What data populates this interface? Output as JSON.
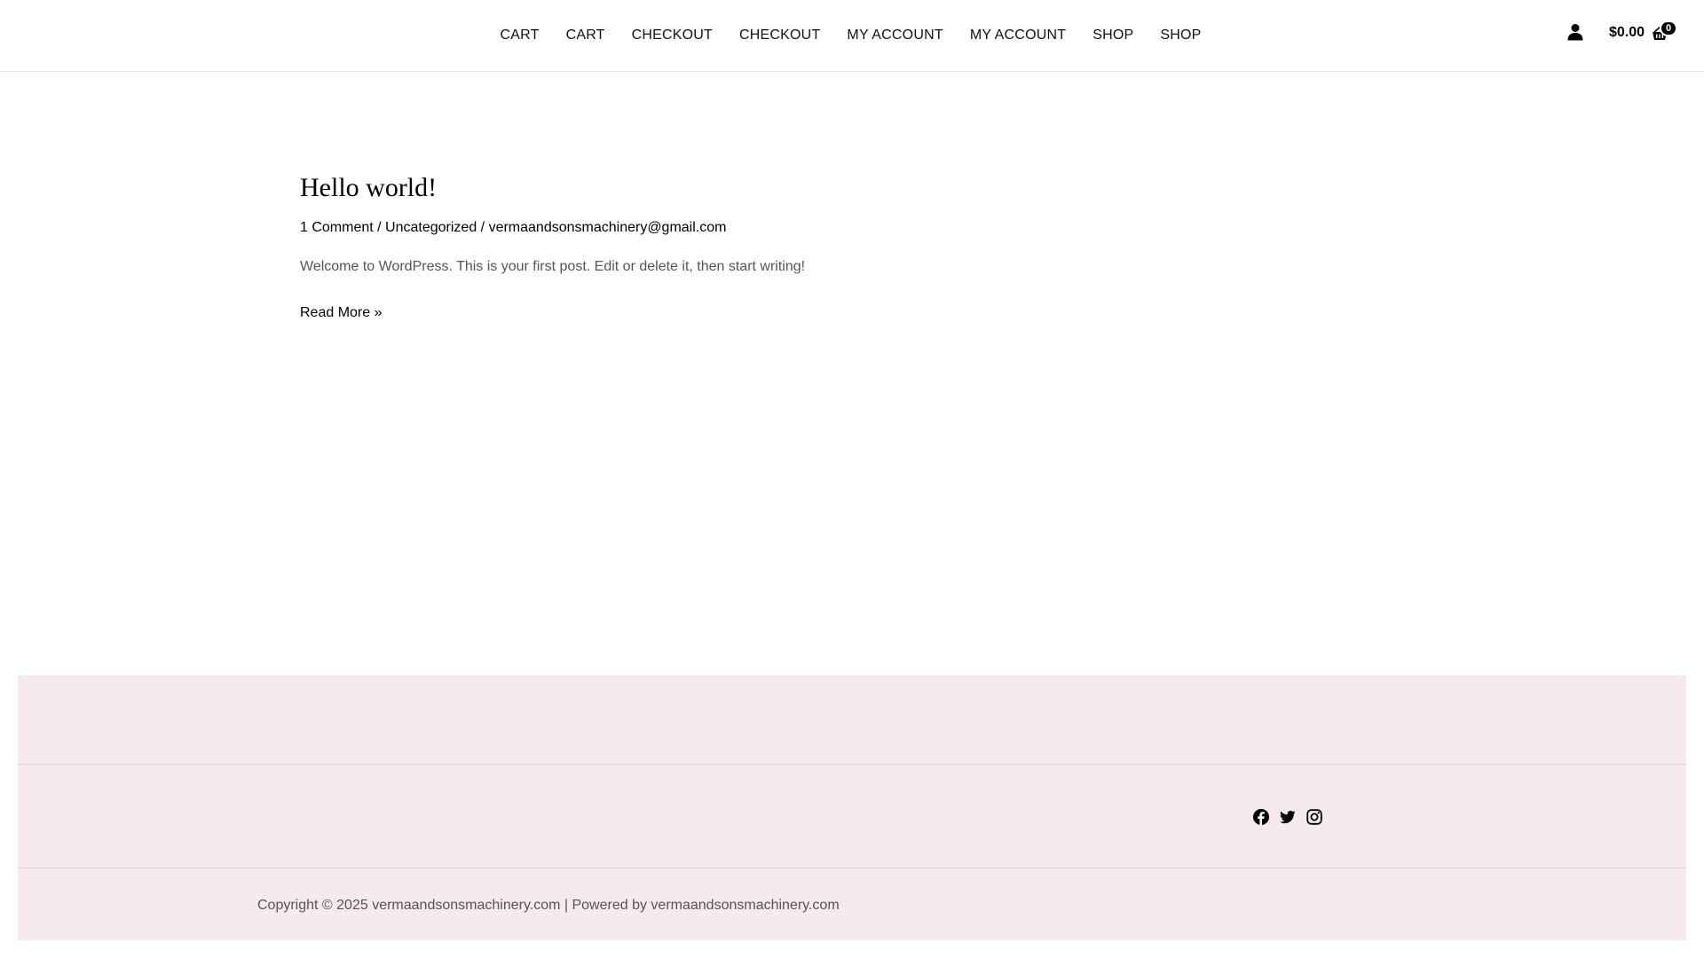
{
  "header": {
    "nav_items": [
      {
        "label": "CART"
      },
      {
        "label": "CART"
      },
      {
        "label": "CHECKOUT"
      },
      {
        "label": "CHECKOUT"
      },
      {
        "label": "MY ACCOUNT"
      },
      {
        "label": "MY ACCOUNT"
      },
      {
        "label": "SHOP"
      },
      {
        "label": "SHOP"
      }
    ],
    "account_icon": "user-icon",
    "cart_total": "$0.00",
    "cart_icon": "basket-icon",
    "cart_count": "0"
  },
  "post": {
    "title": "Hello world!",
    "meta": {
      "comments": "1 Comment",
      "separator1": " / ",
      "category": "Uncategorized",
      "separator2": " / ",
      "author": "vermaandsonsmachinery@gmail.com"
    },
    "excerpt": "Welcome to WordPress. This is your first post. Edit or delete it, then start writing!",
    "read_more": "Read More »"
  },
  "footer": {
    "social": [
      {
        "icon": "facebook-icon"
      },
      {
        "icon": "twitter-icon"
      },
      {
        "icon": "instagram-icon"
      }
    ],
    "copyright": "Copyright © 2025 vermaandsonsmachinery.com | Powered by vermaandsonsmachinery.com"
  },
  "colors": {
    "footer_bg": "#f5eaee",
    "text": "#000000",
    "muted_text": "#555555"
  }
}
